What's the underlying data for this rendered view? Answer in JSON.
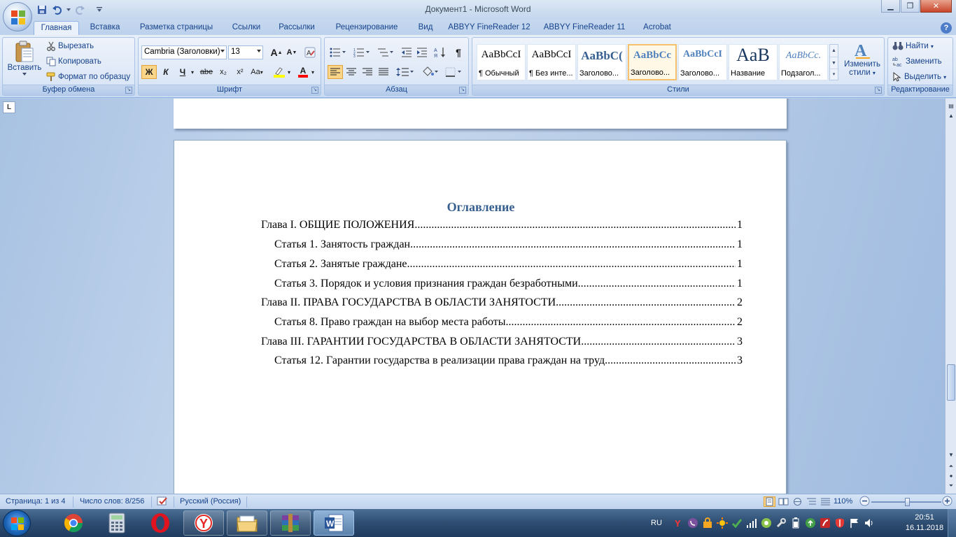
{
  "window": {
    "title": "Документ1 - Microsoft Word"
  },
  "tabs": [
    {
      "label": "Главная"
    },
    {
      "label": "Вставка"
    },
    {
      "label": "Разметка страницы"
    },
    {
      "label": "Ссылки"
    },
    {
      "label": "Рассылки"
    },
    {
      "label": "Рецензирование"
    },
    {
      "label": "Вид"
    },
    {
      "label": "ABBYY FineReader 12"
    },
    {
      "label": "ABBYY FineReader 11"
    },
    {
      "label": "Acrobat"
    }
  ],
  "ribbon": {
    "clipboard": {
      "label": "Буфер обмена",
      "paste": "Вставить",
      "cut": "Вырезать",
      "copy": "Копировать",
      "format_painter": "Формат по образцу"
    },
    "font": {
      "label": "Шрифт",
      "font_name": "Cambria (Заголовки)",
      "font_size": "13",
      "bold": "Ж",
      "italic": "К",
      "underline": "Ч",
      "strike": "abe",
      "subscript": "x₂",
      "superscript": "x²",
      "case": "Aa",
      "grow": "A",
      "shrink": "A",
      "color_letter": "A"
    },
    "paragraph": {
      "label": "Абзац",
      "show_marks": "¶"
    },
    "styles": {
      "label": "Стили",
      "items": [
        {
          "preview": "AaBbCcI",
          "name": "¶ Обычный"
        },
        {
          "preview": "AaBbCcI",
          "name": "¶ Без инте..."
        },
        {
          "preview": "AaBbC(",
          "name": "Заголово..."
        },
        {
          "preview": "AaBbCc",
          "name": "Заголово..."
        },
        {
          "preview": "AaBbCcI",
          "name": "Заголово..."
        },
        {
          "preview": "AaB",
          "name": "Название"
        },
        {
          "preview": "AaBbCc.",
          "name": "Подзагол..."
        }
      ],
      "change_styles_line1": "Изменить",
      "change_styles_line2": "стили"
    },
    "editing": {
      "label": "Редактирование",
      "find": "Найти",
      "replace": "Заменить",
      "select": "Выделить"
    }
  },
  "ruler": {
    "tab_selector": "L"
  },
  "document": {
    "toc_title": "Оглавление",
    "toc": [
      {
        "text": "Глава I. ОБЩИЕ ПОЛОЖЕНИЯ",
        "page": "1",
        "level": 1
      },
      {
        "text": "Статья 1. Занятость граждан",
        "page": "1",
        "level": 2
      },
      {
        "text": "Статья 2. Занятые граждане",
        "page": "1",
        "level": 2
      },
      {
        "text": "Статья 3. Порядок и условия признания граждан безработными",
        "page": "1",
        "level": 2
      },
      {
        "text": "Глава II. ПРАВА ГОСУДАРСТВА В ОБЛАСТИ ЗАНЯТОСТИ",
        "page": "2",
        "level": 1
      },
      {
        "text": "Статья 8. Право граждан на выбор места работы",
        "page": "2",
        "level": 2
      },
      {
        "text": "Глава III. ГАРАНТИИ ГОСУДАРСТВА В ОБЛАСТИ ЗАНЯТОСТИ",
        "page": "3",
        "level": 1
      },
      {
        "text": "Статья 12. Гарантии государства в реализации права граждан на труд",
        "page": "3",
        "level": 2
      }
    ]
  },
  "statusbar": {
    "page": "Страница: 1 из 4",
    "words": "Число слов: 8/256",
    "language": "Русский (Россия)",
    "zoom": "110%"
  },
  "taskbar": {
    "language": "RU",
    "time": "20:51",
    "date": "16.11.2018"
  }
}
